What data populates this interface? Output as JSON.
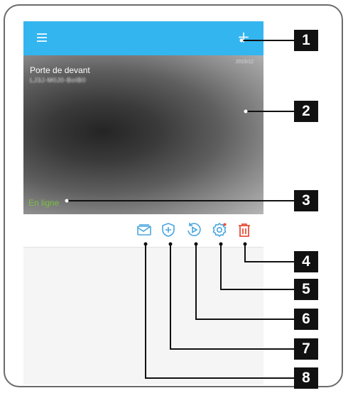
{
  "camera": {
    "name": "Porte de devant",
    "id": "LJ3J-M0J0-BoIB0",
    "timestamp": "2015/12",
    "status": "En ligne"
  },
  "icons": {
    "menu": "hamburger-menu-icon",
    "add": "plus-icon",
    "message": "envelope-icon",
    "shield": "shield-plus-icon",
    "replay": "playback-icon",
    "settings": "gear-icon",
    "delete": "trash-icon"
  },
  "colors": {
    "appbar": "#33b5f0",
    "action_icon": "#4aa6dd",
    "delete_icon": "#e8503a",
    "status": "#7bc043",
    "callout": "#111111"
  },
  "callouts": [
    "1",
    "2",
    "3",
    "4",
    "5",
    "6",
    "7",
    "8"
  ]
}
